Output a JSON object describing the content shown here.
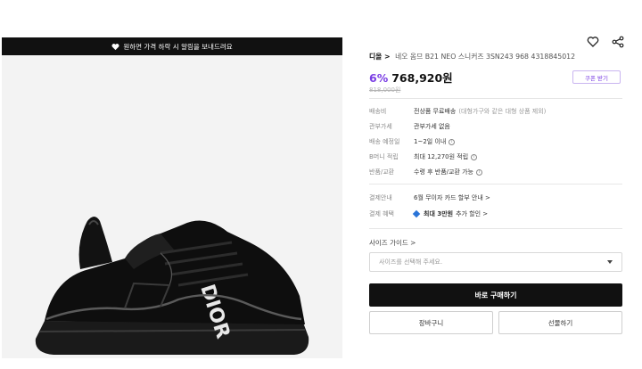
{
  "banner": {
    "text": "원하면 가격 하락 시 알림을 보내드려요",
    "icon": "heart-icon"
  },
  "product": {
    "brand": "디올 >",
    "name": "네오 옴므 B21 NEO 스니커즈 3SN243 968 4318845012",
    "discount": "6%",
    "price": "768,920원",
    "original_price": "818,000원",
    "coupon_label": "쿠폰 받기",
    "image_alt": "검정 니트 스니커즈"
  },
  "actions": {
    "wishlist_icon": "heart-outline-icon",
    "share_icon": "share-icon"
  },
  "specs": [
    {
      "key": "배송비",
      "value": "전상품 무료배송",
      "sub": "(대형가구와 같은 대형 상품 제외)"
    },
    {
      "key": "관부가세",
      "value": "관부가세 없음",
      "sub": ""
    },
    {
      "key": "배송 예정일",
      "value": "1~2일 이내",
      "sub": ""
    },
    {
      "key": "B머니 적립",
      "value": "최대 12,270원 적립",
      "sub": ""
    },
    {
      "key": "반품/교환",
      "value": "수령 후 반품/교환 가능",
      "sub": ""
    }
  ],
  "payment": [
    {
      "key": "결제안내",
      "value": "6월 무이자 카드 할부 안내 >"
    },
    {
      "key": "결제 혜택",
      "value": "최대 3만원",
      "value_suffix": " 추가 할인 >"
    }
  ],
  "size": {
    "label": "사이즈 가이드 >",
    "placeholder": "사이즈를 선택해 주세요."
  },
  "buttons": {
    "buy": "바로 구매하기",
    "cart": "장바구니",
    "gift": "선물하기"
  },
  "colors": {
    "accent": "#7b3fe4",
    "dark": "#111111",
    "link_blue": "#2a74d8"
  }
}
